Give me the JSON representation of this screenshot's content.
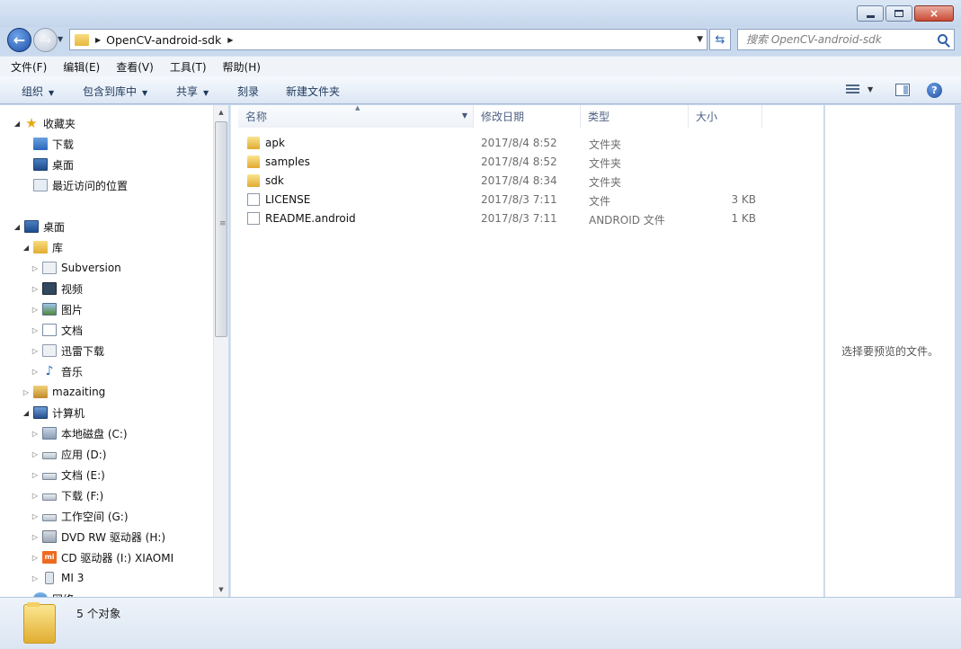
{
  "window": {
    "controls": {
      "minimize": "minimize",
      "maximize": "maximize",
      "close": "×"
    }
  },
  "address": {
    "path": "OpenCV-android-sdk",
    "search_placeholder": "搜索 OpenCV-android-sdk"
  },
  "menu": [
    "文件(F)",
    "编辑(E)",
    "查看(V)",
    "工具(T)",
    "帮助(H)"
  ],
  "commands": {
    "organize": "组织",
    "include_library": "包含到库中",
    "share": "共享",
    "burn": "刻录",
    "new_folder": "新建文件夹"
  },
  "nav": {
    "favorites": "收藏夹",
    "downloads": "下载",
    "desktop_fav": "桌面",
    "recent": "最近访问的位置",
    "desktop": "桌面",
    "libraries": "库",
    "lib_items": [
      "Subversion",
      "视频",
      "图片",
      "文档",
      "迅雷下载",
      "音乐"
    ],
    "user": "mazaiting",
    "computer": "计算机",
    "drives": [
      "本地磁盘 (C:)",
      "应用 (D:)",
      "文档 (E:)",
      "下载 (F:)",
      "工作空间 (G:)",
      "DVD RW 驱动器 (H:)",
      "CD 驱动器 (I:) XIAOMI",
      "MI 3"
    ],
    "network": "网络"
  },
  "columns": {
    "name": "名称",
    "date": "修改日期",
    "type": "类型",
    "size": "大小"
  },
  "files": [
    {
      "name": "apk",
      "date": "2017/8/4 8:52",
      "type": "文件夹",
      "size": "",
      "icon": "folder-icon"
    },
    {
      "name": "samples",
      "date": "2017/8/4 8:52",
      "type": "文件夹",
      "size": "",
      "icon": "folder-icon"
    },
    {
      "name": "sdk",
      "date": "2017/8/4 8:34",
      "type": "文件夹",
      "size": "",
      "icon": "folder-icon"
    },
    {
      "name": "LICENSE",
      "date": "2017/8/3 7:11",
      "type": "文件",
      "size": "3 KB",
      "icon": "file-icon"
    },
    {
      "name": "README.android",
      "date": "2017/8/3 7:11",
      "type": "ANDROID 文件",
      "size": "1 KB",
      "icon": "file-icon"
    }
  ],
  "preview": {
    "empty_text": "选择要预览的文件。"
  },
  "status": {
    "count": "5 个对象"
  },
  "colors": {
    "accent": "#1e395b",
    "chrome": "#c9d9ee",
    "selection_blue": "#2b67b9"
  }
}
